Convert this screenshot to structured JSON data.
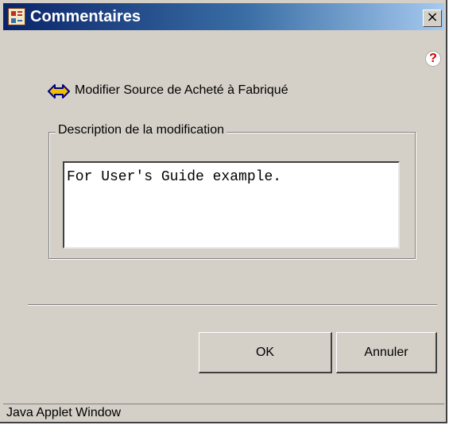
{
  "window": {
    "title": "Commentaires",
    "close_label": "×",
    "help_label": "?"
  },
  "action": {
    "text": "Modifier Source de Acheté à Fabriqué",
    "icon": "swap-arrows-icon"
  },
  "description": {
    "legend": "Description de la modification",
    "value": "For User's Guide example."
  },
  "buttons": {
    "ok": "OK",
    "cancel": "Annuler"
  },
  "status": {
    "text": "Java Applet Window"
  },
  "colors": {
    "titlebar_start": "#0a246a",
    "titlebar_end": "#a6caf0",
    "dialog_bg": "#d4d0c8",
    "help_icon": "#cc0000",
    "swap_icon_fill": "#f0c000",
    "swap_icon_outline": "#000080"
  }
}
